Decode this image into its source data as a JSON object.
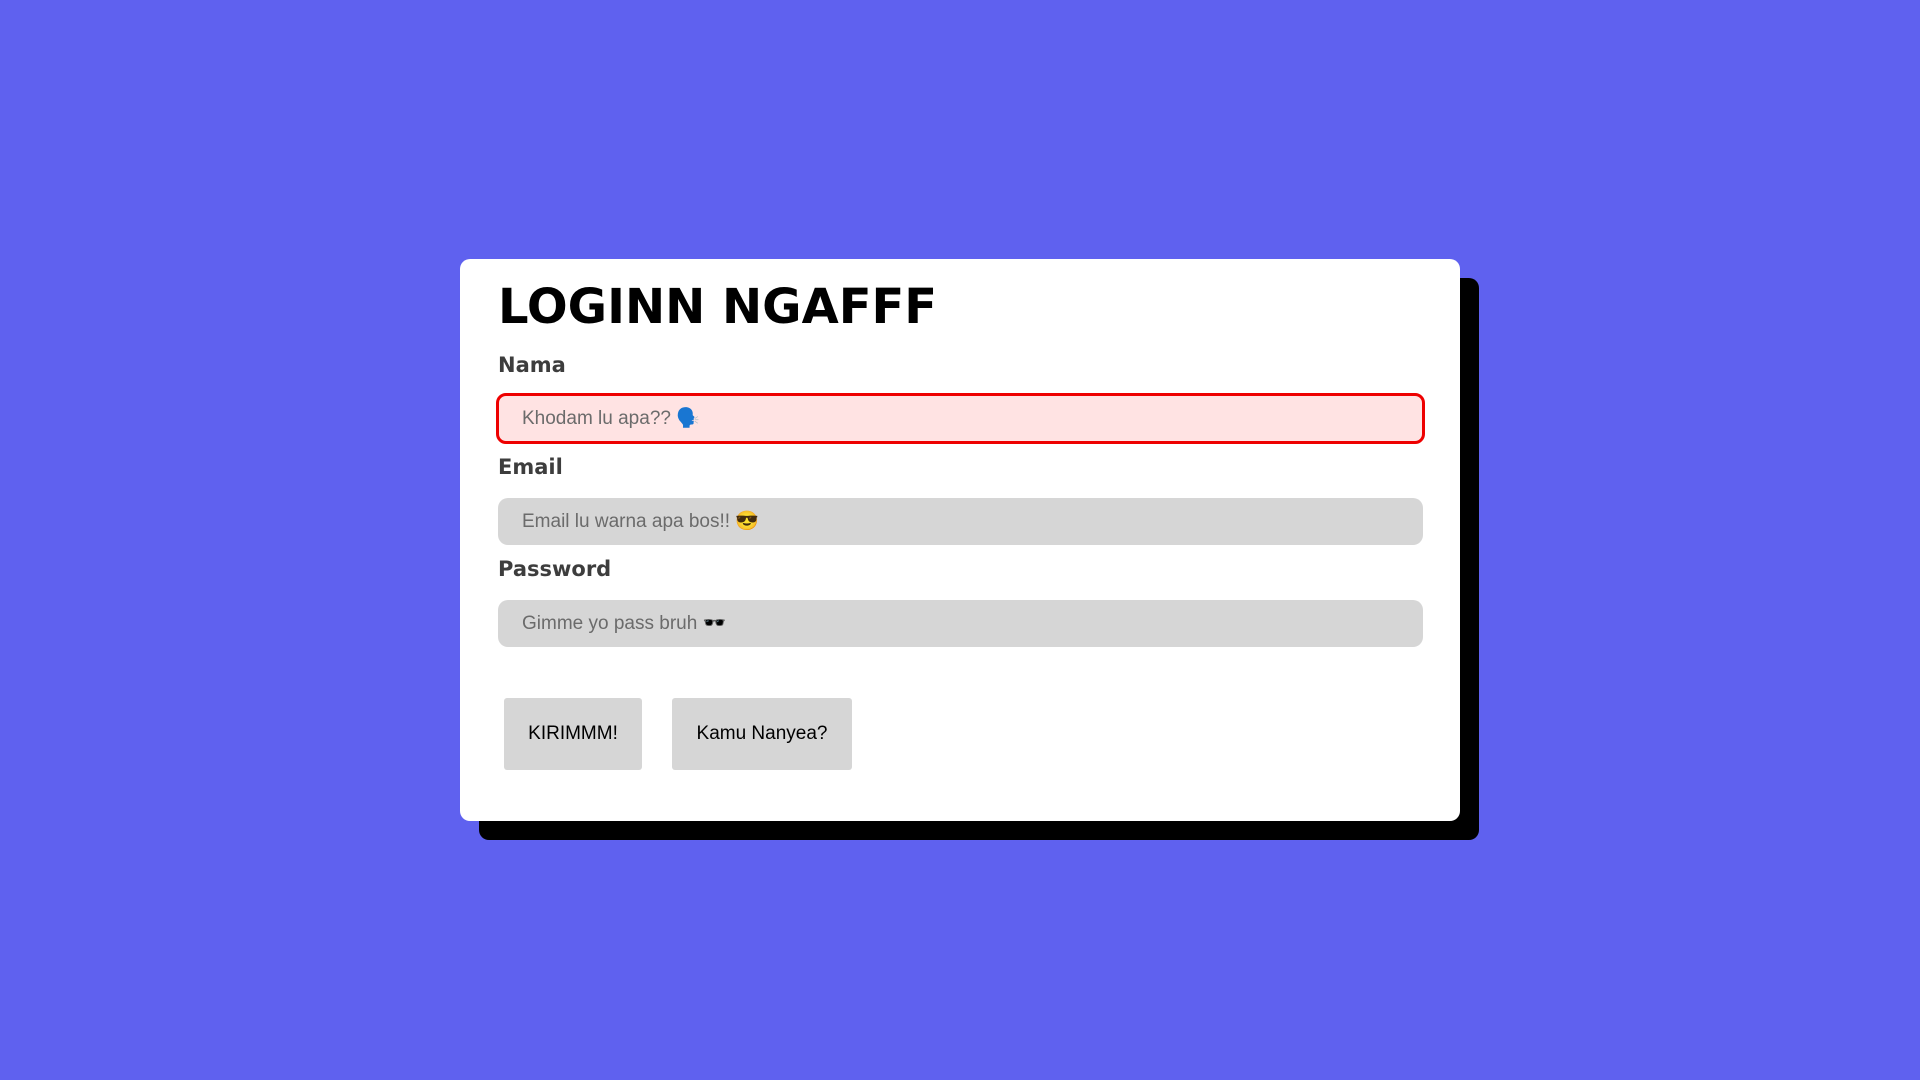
{
  "form": {
    "title": "LOGINN NGAFFF",
    "fields": [
      {
        "label": "Nama",
        "placeholder": "Khodam lu apa?? 🗣️",
        "value": "",
        "state": "error"
      },
      {
        "label": "Email",
        "placeholder": "Email lu warna apa bos!! 😎",
        "value": "",
        "state": "normal"
      },
      {
        "label": "Password",
        "placeholder": "Gimme yo pass bruh 🕶️",
        "value": "",
        "state": "normal"
      }
    ],
    "buttons": {
      "submit_label": "KIRIMMM!",
      "secondary_label": "Kamu Nanyea?"
    }
  },
  "colors": {
    "background": "#5f61ef",
    "card": "#ffffff",
    "card_shadow": "#000000",
    "input_bg": "#d6d6d6",
    "error_border": "#ee0000",
    "error_bg": "#ffe3e3",
    "label_text": "#3d3d3d"
  }
}
